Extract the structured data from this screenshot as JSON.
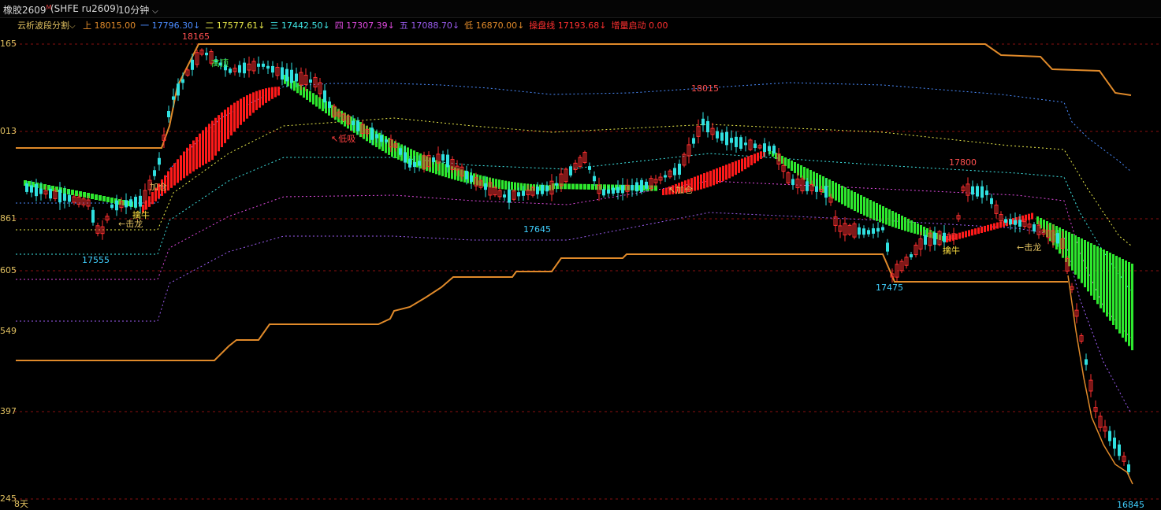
{
  "header": {
    "instrument": "橡胶2609",
    "instrument_sup": "M",
    "code": "(SHFE ru2609)",
    "period": "10分钟",
    "period_icon": "chevron-down-icon"
  },
  "indicator": {
    "name": "云析波段分割",
    "items": [
      {
        "label": "上",
        "value": "18015.00",
        "color": "#e08a2a",
        "arrow": ""
      },
      {
        "label": "一",
        "value": "17796.30",
        "color": "#4b8cff",
        "arrow": "↓"
      },
      {
        "label": "二",
        "value": "17577.61",
        "color": "#e8e84a",
        "arrow": "↓"
      },
      {
        "label": "三",
        "value": "17442.50",
        "color": "#40e8e8",
        "arrow": "↓"
      },
      {
        "label": "四",
        "value": "17307.39",
        "color": "#e04ae0",
        "arrow": "↓"
      },
      {
        "label": "五",
        "value": "17088.70",
        "color": "#9b5cf0",
        "arrow": "↓"
      },
      {
        "label": "低",
        "value": "16870.00",
        "color": "#e08a2a",
        "arrow": "↓"
      },
      {
        "label": "操盘线",
        "value": "17193.68",
        "color": "#ff3030",
        "arrow": "↓"
      },
      {
        "label": "增量启动",
        "value": "0.00",
        "color": "#ff3030",
        "arrow": ""
      }
    ]
  },
  "y_axis_ticks": [
    "165",
    "013",
    "861",
    "605",
    "549",
    "397",
    "245"
  ],
  "footer": {
    "days": "8天"
  },
  "annotations": {
    "peak_labels": [
      "18165",
      "18015",
      "17800"
    ],
    "trough_labels": [
      "17555",
      "17645",
      "17475",
      "16845"
    ],
    "signals": [
      "加仓",
      "擒牛",
      "←击龙",
      "高顶",
      "↖低吸",
      "↖加仓",
      "←击龙",
      "擒牛"
    ]
  },
  "colors": {
    "up_candle": "#ff3030",
    "down_candle": "#30e0e0",
    "band_upper": "#e08a2a",
    "trend_up": "#ff1a1a",
    "trend_down": "#2ee82e",
    "grid_line": "#8a1010"
  }
}
